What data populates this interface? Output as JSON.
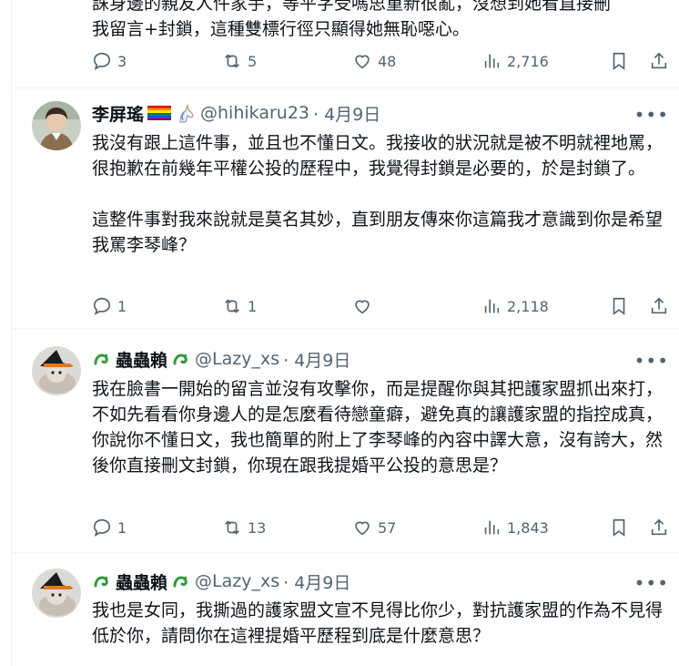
{
  "tweets": [
    {
      "text_lines": [
        "誅身邊的親友人件家手，等平字受嗎思重新很亂，沒想到她看直接刪",
        "我留言+封鎖，這種雙標行徑只顯得她無恥噁心。"
      ],
      "replies": "3",
      "retweets": "5",
      "likes": "48",
      "views": "2,716"
    },
    {
      "name": "李屏瑤",
      "handle": "@hihikaru23",
      "date": "· 4月9日",
      "paragraphs": [
        "我沒有跟上這件事，並且也不懂日文。我接收的狀況就是被不明就裡地罵，很抱歉在前幾年平權公投的歷程中，我覺得封鎖是必要的，於是封鎖了。",
        "這整件事對我來說就是莫名其妙，直到朋友傳來你這篇我才意識到你是希望我罵李琴峰？"
      ],
      "replies": "1",
      "retweets": "1",
      "likes": "",
      "views": "2,118"
    },
    {
      "name": "蟲蟲賴",
      "handle": "@Lazy_xs",
      "date": "· 4月9日",
      "paragraphs": [
        "我在臉書一開始的留言並沒有攻擊你，而是提醒你與其把護家盟抓出來打，不如先看看你身邊人的是怎麼看待戀童癖，避免真的讓護家盟的指控成真，你說你不懂日文，我也簡單的附上了李琴峰的內容中譯大意，沒有誇大，然後你直接刪文封鎖，你現在跟我提婚平公投的意思是？"
      ],
      "replies": "1",
      "retweets": "13",
      "likes": "57",
      "views": "1,843"
    },
    {
      "name": "蟲蟲賴",
      "handle": "@Lazy_xs",
      "date": "· 4月9日",
      "paragraphs": [
        "我也是女同，我撕過的護家盟文宣不見得比你少，對抗護家盟的作為不見得低於你，請問你在這裡提婚平歷程到底是什麼意思？"
      ]
    }
  ],
  "more_glyph": "•••",
  "colors": {
    "secondary": "#536471",
    "text": "#0f1419",
    "border": "#eff3f4"
  }
}
